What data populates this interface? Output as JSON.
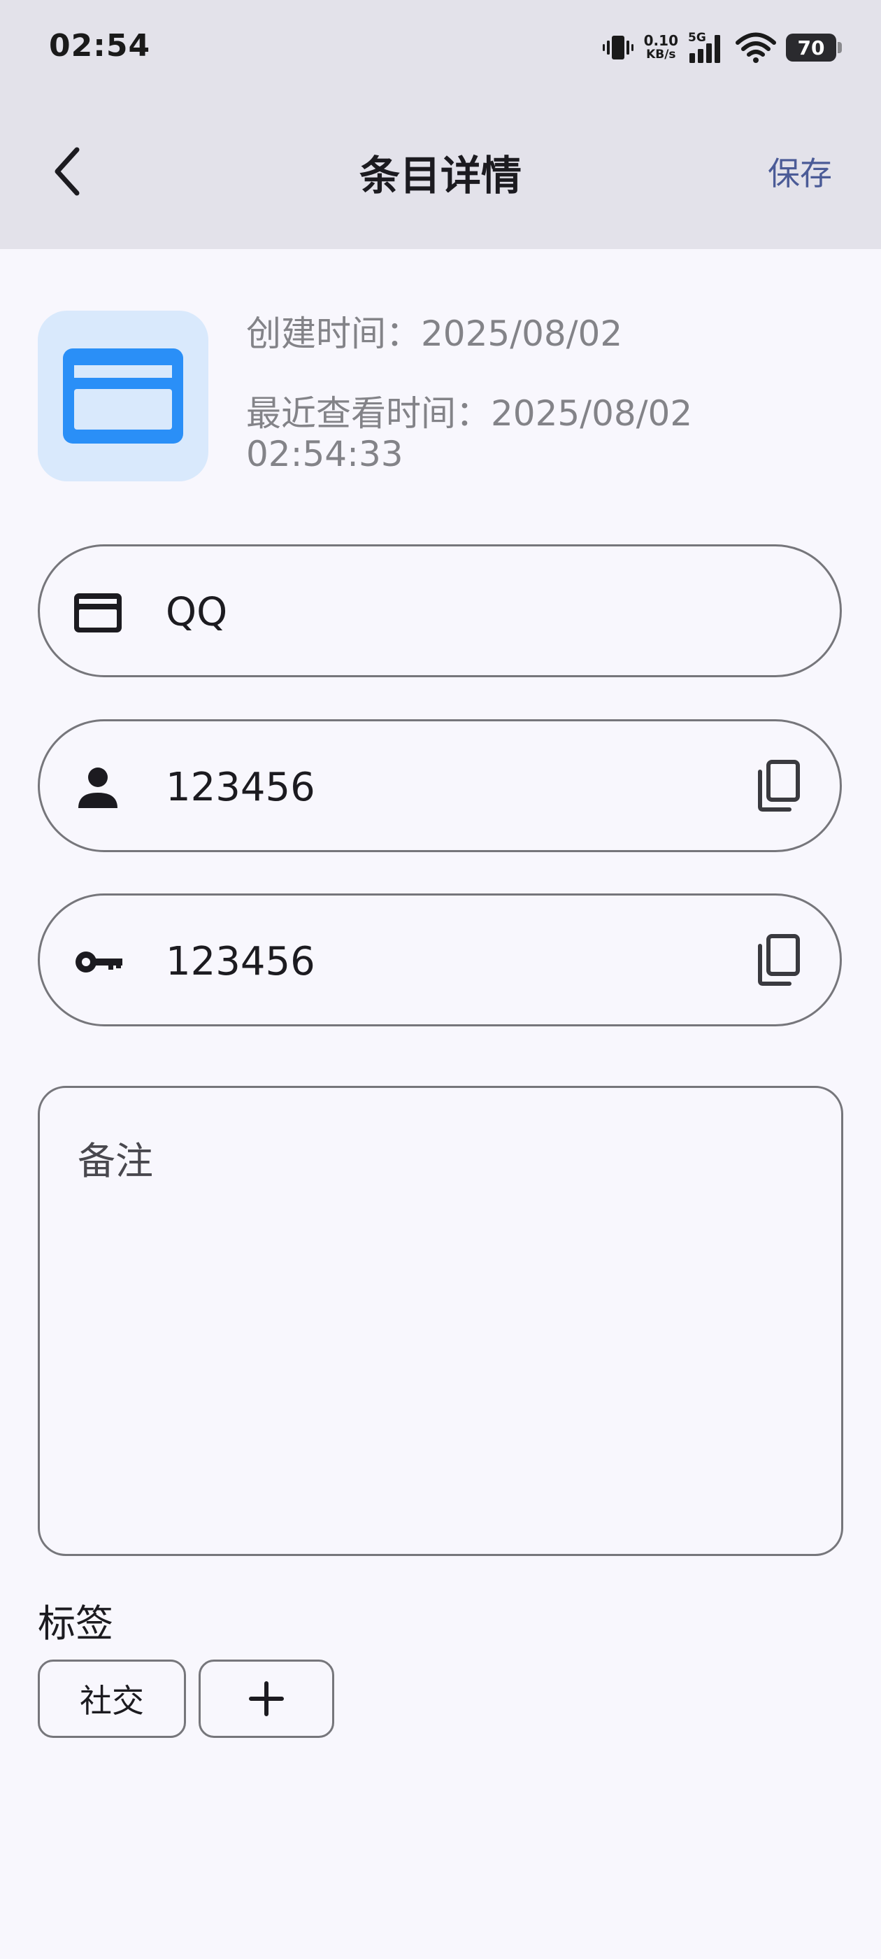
{
  "status_bar": {
    "time": "02:54",
    "net_speed_value": "0.10",
    "net_speed_unit": "KB/s",
    "signal_label": "5G",
    "battery": "70",
    "icons": [
      "vibrate-icon",
      "signal-icon",
      "wifi-icon",
      "battery-icon"
    ]
  },
  "header": {
    "back_icon": "chevron-left-icon",
    "title": "条目详情",
    "save_label": "保存"
  },
  "entry": {
    "icon": "credit-card-icon",
    "created_label": "创建时间：2025/08/02",
    "viewed_label": "最近查看时间：2025/08/02 02:54:33"
  },
  "fields": {
    "name": {
      "icon": "credit-card-icon",
      "value": "QQ"
    },
    "username": {
      "icon": "person-icon",
      "value": "123456",
      "copy_icon": "copy-icon"
    },
    "password": {
      "icon": "key-icon",
      "value": "123456",
      "copy_icon": "copy-icon"
    }
  },
  "notes": {
    "placeholder": "备注"
  },
  "tags": {
    "label": "标签",
    "items": [
      "社交"
    ],
    "add_icon": "plus-icon"
  },
  "colors": {
    "app_bar": "#e3e2ea",
    "background": "#f8f7fd",
    "accent": "#4b5b97",
    "icon_blue": "#2a8ff7",
    "icon_tile": "#d9e9fc",
    "outline": "#76767b"
  }
}
